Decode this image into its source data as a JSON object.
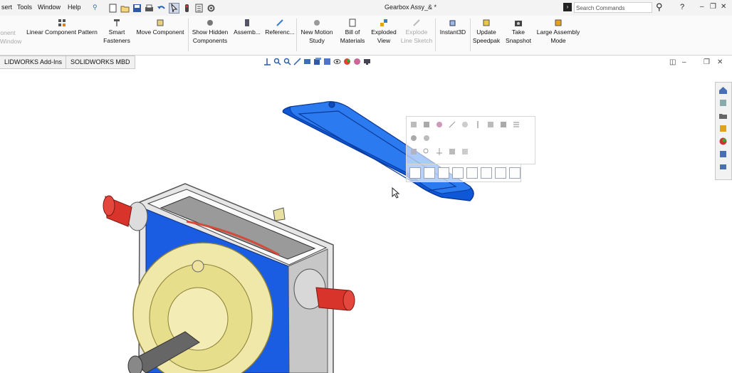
{
  "menu": {
    "items": [
      "sert",
      "Tools",
      "Window",
      "Help"
    ]
  },
  "title": "Gearbox Assy_& *",
  "search": {
    "placeholder": "Search Commands"
  },
  "ribbon": {
    "items": [
      {
        "label": "onent\nWindow",
        "disabled": true
      },
      {
        "label": "Linear Component Pattern"
      },
      {
        "label": "Smart\nFasteners"
      },
      {
        "label": "Move Component"
      },
      {
        "label": "Show Hidden\nComponents"
      },
      {
        "label": "Assemb..."
      },
      {
        "label": "Referenc..."
      },
      {
        "label": "New Motion\nStudy"
      },
      {
        "label": "Bill of\nMaterials"
      },
      {
        "label": "Exploded\nView"
      },
      {
        "label": "Explode\nLine Sketch",
        "disabled": true
      },
      {
        "label": "Instant3D"
      },
      {
        "label": "Update\nSpeedpak"
      },
      {
        "label": "Take\nSnapshot"
      },
      {
        "label": "Large Assembly\nMode"
      }
    ]
  },
  "tabs": [
    "LIDWORKS Add-Ins",
    "SOLIDWORKS MBD"
  ],
  "colors": {
    "housing": "#e2e2e2",
    "blue": "#1a5fe0",
    "yellow": "#efe8a6",
    "red": "#d9342b",
    "lid": "#1464ea"
  },
  "icons": {
    "taskpane": [
      "home-icon",
      "resources-icon",
      "design-library-icon",
      "file-explorer-icon",
      "appearances-icon",
      "custom-properties-icon",
      "forum-icon"
    ]
  }
}
